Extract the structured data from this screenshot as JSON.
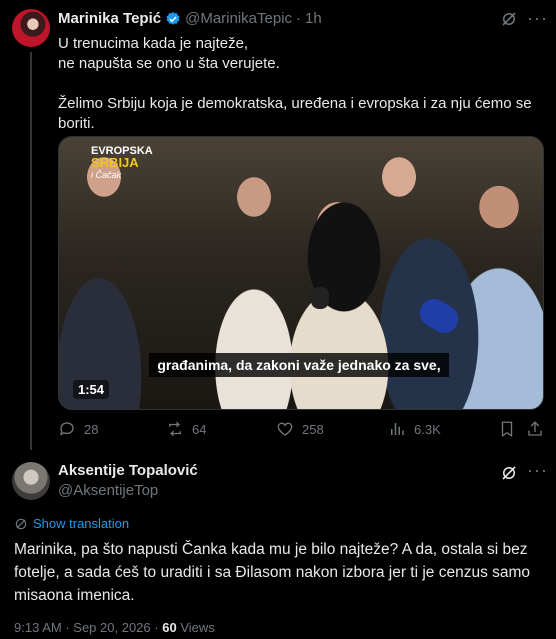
{
  "post1": {
    "author_name": "Marinika Tepić",
    "handle": "@MarinikaTepic",
    "separator": "·",
    "time": "1h",
    "text": "U trenucima kada je najteže,\nne napušta se ono u šta verujete.\n\nŽelimo Srbiju koja je demokratska, uređena i evropska i za nju ćemo se boriti.",
    "media": {
      "logo_line1": "EVROPSKA",
      "logo_line2": "SRBIJA",
      "logo_line3": "i Čačak",
      "subtitle": "građanima, da zakoni važe jednako za sve,",
      "duration": "1:54"
    },
    "actions": {
      "replies": "28",
      "reposts": "64",
      "likes": "258",
      "views": "6.3K"
    }
  },
  "post2": {
    "author_name": "Aksentije Topalović",
    "handle": "@AksentijeTop",
    "translate_label": "Show translation",
    "text": "Marinika, pa što napusti Čanka kada mu je bilo najteže? A da, ostala si bez fotelje, a sada ćeš to uraditi i sa Đilasom nakon izbora jer ti je cenzus samo misaona imenica.",
    "time": "9:13 AM",
    "date": "Sep 20, 2026",
    "views_count": "60",
    "views_label": "Views"
  },
  "icons": [
    "verified-icon",
    "grok-icon",
    "more-icon",
    "reply-icon",
    "repost-icon",
    "like-icon",
    "views-icon",
    "bookmark-icon",
    "share-icon",
    "translate-icon"
  ],
  "colors": {
    "accent": "#1d9bf0",
    "muted": "#71767b",
    "text": "#e7e9ea",
    "background": "#000000"
  }
}
